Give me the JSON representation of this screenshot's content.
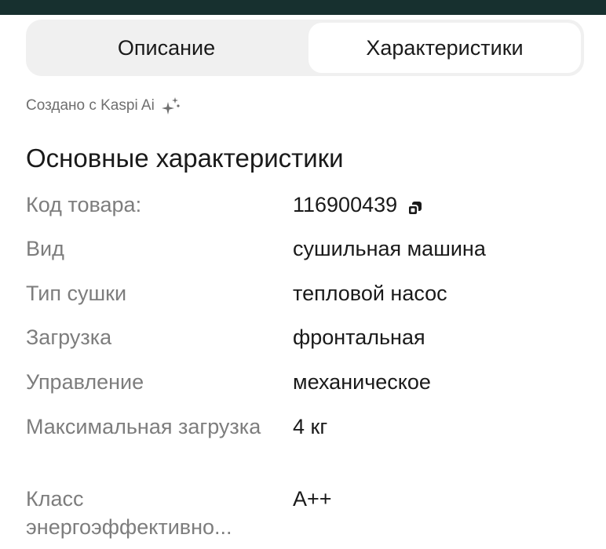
{
  "tabs": {
    "description_label": "Описание",
    "characteristics_label": "Характеристики",
    "active": "characteristics"
  },
  "ai_note": {
    "text": "Создано с Kaspi Ai",
    "icon": "sparkle-icon"
  },
  "section": {
    "title": "Основные характеристики"
  },
  "specs": [
    {
      "label": "Код товара:",
      "value": "116900439",
      "icon": "copy-icon"
    },
    {
      "label": "Вид",
      "value": "сушильная машина"
    },
    {
      "label": "Тип сушки",
      "value": "тепловой насос"
    },
    {
      "label": "Загрузка",
      "value": "фронтальная"
    },
    {
      "label": "Управление",
      "value": "механическое"
    },
    {
      "label": "Максимальная загрузка",
      "value": "4 кг"
    },
    {
      "label": "Класс энергоэффективно...",
      "value": "A++"
    }
  ],
  "colors": {
    "top_bar": "#17302f",
    "tab_bg": "#f0f0f0",
    "label_text": "#7d7d7d"
  }
}
